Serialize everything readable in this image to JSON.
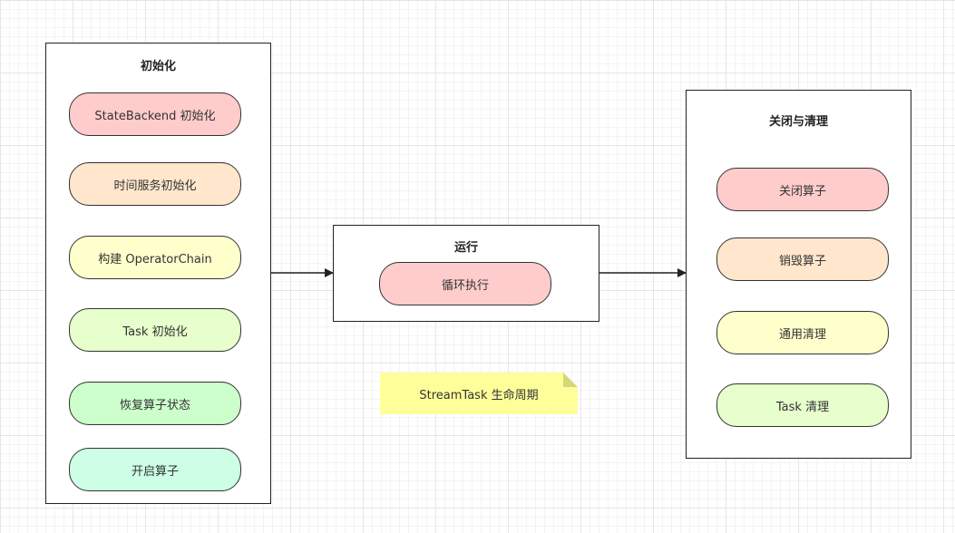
{
  "init": {
    "title": "初始化",
    "steps": [
      "StateBackend 初始化",
      "时间服务初始化",
      "构建 OperatorChain",
      "Task 初始化",
      "恢复算子状态",
      "开启算子"
    ]
  },
  "run": {
    "title": "运行",
    "steps": [
      "循环执行"
    ]
  },
  "close": {
    "title": "关闭与清理",
    "steps": [
      "关闭算子",
      "销毁算子",
      "通用清理",
      "Task 清理"
    ]
  },
  "note": "StreamTask 生命周期"
}
